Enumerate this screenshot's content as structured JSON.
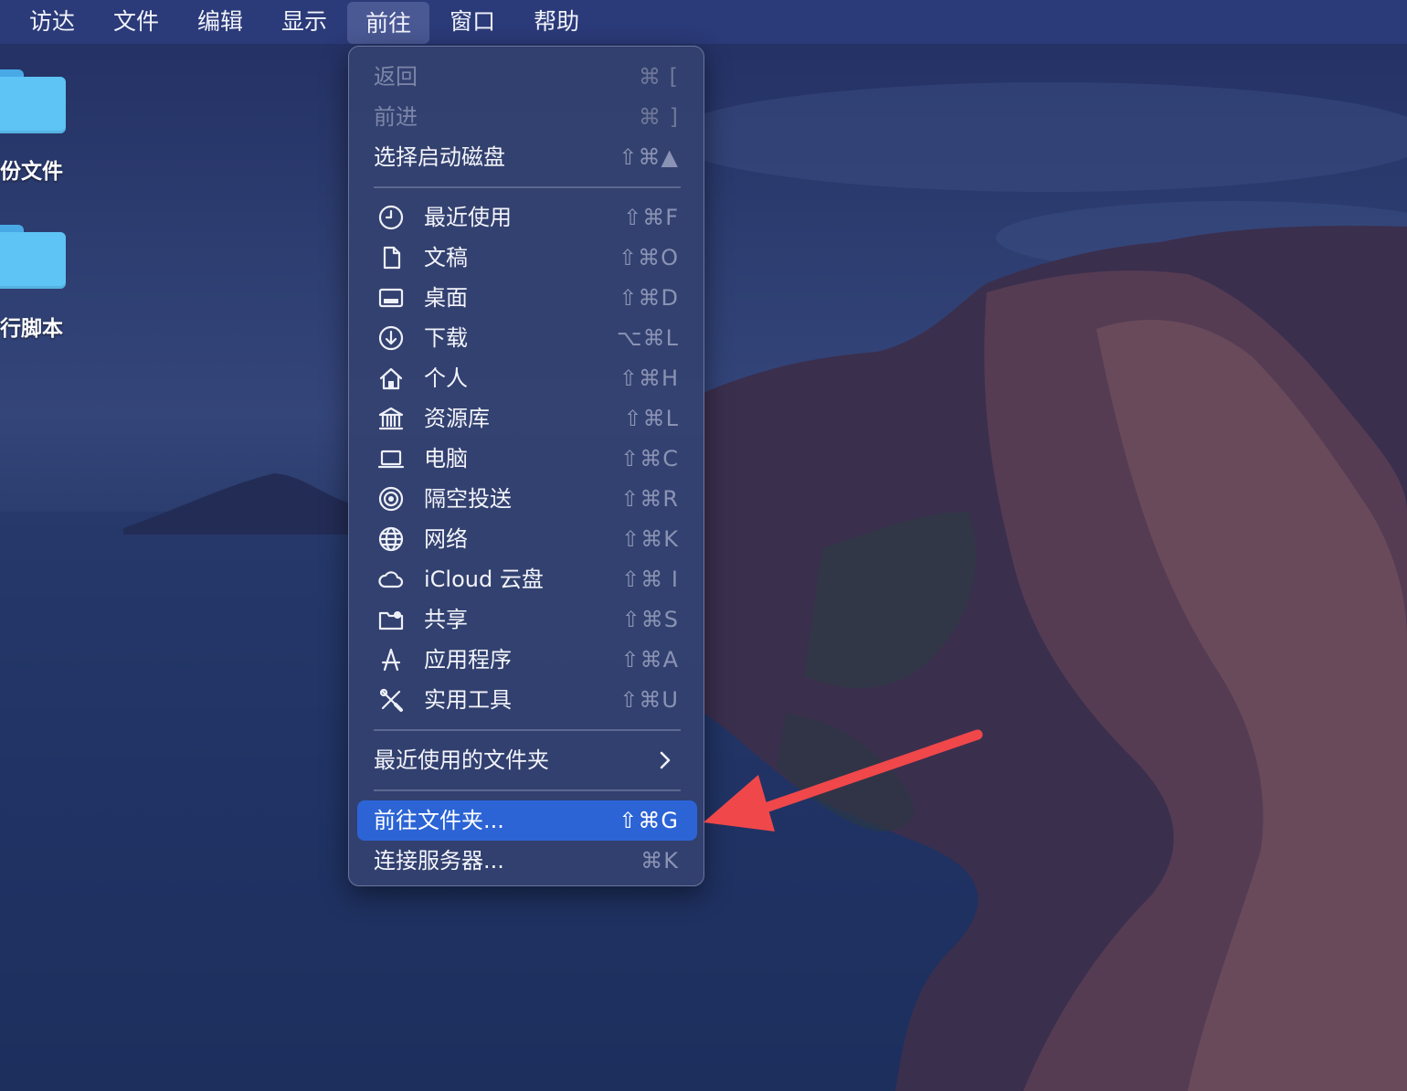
{
  "menubar": {
    "items": [
      "访达",
      "文件",
      "编辑",
      "显示",
      "前往",
      "窗口",
      "帮助"
    ],
    "active_index": 4
  },
  "desktop": {
    "icons": [
      {
        "label": "份文件",
        "icon": "folder-icon"
      },
      {
        "label": "行脚本",
        "icon": "folder-icon"
      }
    ]
  },
  "go_menu": {
    "items": [
      {
        "label": "返回",
        "shortcut": "⌘ [",
        "disabled": true
      },
      {
        "label": "前进",
        "shortcut": "⌘ ]",
        "disabled": true
      },
      {
        "label": "选择启动磁盘",
        "shortcut": "⇧⌘▲"
      },
      {
        "label": "最近使用",
        "shortcut": "⇧⌘F",
        "icon": "clock-icon"
      },
      {
        "label": "文稿",
        "shortcut": "⇧⌘O",
        "icon": "document-icon"
      },
      {
        "label": "桌面",
        "shortcut": "⇧⌘D",
        "icon": "desktop-icon"
      },
      {
        "label": "下载",
        "shortcut": "⌥⌘L",
        "icon": "download-icon"
      },
      {
        "label": "个人",
        "shortcut": "⇧⌘H",
        "icon": "home-icon"
      },
      {
        "label": "资源库",
        "shortcut": "⇧⌘L",
        "icon": "library-icon"
      },
      {
        "label": "电脑",
        "shortcut": "⇧⌘C",
        "icon": "laptop-icon"
      },
      {
        "label": "隔空投送",
        "shortcut": "⇧⌘R",
        "icon": "airdrop-icon"
      },
      {
        "label": "网络",
        "shortcut": "⇧⌘K",
        "icon": "globe-icon"
      },
      {
        "label": "iCloud 云盘",
        "shortcut": "⇧⌘ I",
        "icon": "cloud-icon"
      },
      {
        "label": "共享",
        "shortcut": "⇧⌘S",
        "icon": "shared-folder-icon"
      },
      {
        "label": "应用程序",
        "shortcut": "⇧⌘A",
        "icon": "applications-icon"
      },
      {
        "label": "实用工具",
        "shortcut": "⇧⌘U",
        "icon": "tools-icon"
      },
      {
        "label": "最近使用的文件夹",
        "submenu": true
      },
      {
        "label": "前往文件夹...",
        "shortcut": "⇧⌘G",
        "selected": true
      },
      {
        "label": "连接服务器...",
        "shortcut": "⌘K"
      }
    ]
  },
  "colors": {
    "menubar_bg": "#2b3a78",
    "menu_bg": "#344270",
    "selected_bg": "#2c64d6",
    "arrow": "#f0474a",
    "folder": "#5ec3f5"
  }
}
